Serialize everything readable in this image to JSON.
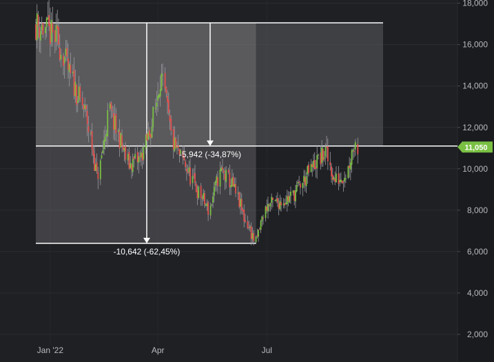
{
  "chart_data": {
    "type": "candlestick",
    "y_ticks": [
      "2,000",
      "4,000",
      "6,000",
      "8,000",
      "10,000",
      "12,000",
      "14,000",
      "16,000",
      "18,000"
    ],
    "y_tick_values": [
      2000,
      4000,
      6000,
      8000,
      10000,
      12000,
      14000,
      16000,
      18000
    ],
    "ylim": [
      1000,
      18000
    ],
    "x_ticks": [
      "Jan '22",
      "Apr",
      "Jul"
    ],
    "x_tick_dates": [
      "2022-01-01",
      "2022-04-01",
      "2022-07-01"
    ],
    "current_price": {
      "label": "11,050",
      "value": 11050,
      "color": "#7ac043"
    },
    "annotations": [
      {
        "text": "-5,942 (-34,87%)",
        "from_value": 17050,
        "to_value": 11100
      },
      {
        "text": "-10,642 (-62,45%)",
        "from_value": 17050,
        "to_value": 6400
      }
    ],
    "measure_range": {
      "start": "2021-12-20",
      "end": "2022-06-22"
    },
    "colors": {
      "up": "#7ac043",
      "down": "#e2524f"
    },
    "series": [
      {
        "date": "2021-12-20",
        "value": 17000
      },
      {
        "date": "2021-12-29",
        "value": 16700
      },
      {
        "date": "2022-01-08",
        "value": 16200
      },
      {
        "date": "2022-01-18",
        "value": 14500
      },
      {
        "date": "2022-02-01",
        "value": 12500
      },
      {
        "date": "2022-02-10",
        "value": 9500
      },
      {
        "date": "2022-02-20",
        "value": 12800
      },
      {
        "date": "2022-02-28",
        "value": 11500
      },
      {
        "date": "2022-03-08",
        "value": 10200
      },
      {
        "date": "2022-03-18",
        "value": 10500
      },
      {
        "date": "2022-03-28",
        "value": 12200
      },
      {
        "date": "2022-04-04",
        "value": 14600
      },
      {
        "date": "2022-04-14",
        "value": 11200
      },
      {
        "date": "2022-04-24",
        "value": 10200
      },
      {
        "date": "2022-05-04",
        "value": 9000
      },
      {
        "date": "2022-05-14",
        "value": 8000
      },
      {
        "date": "2022-05-24",
        "value": 9900
      },
      {
        "date": "2022-06-03",
        "value": 9200
      },
      {
        "date": "2022-06-13",
        "value": 7600
      },
      {
        "date": "2022-06-22",
        "value": 6450
      },
      {
        "date": "2022-07-01",
        "value": 8200
      },
      {
        "date": "2022-07-11",
        "value": 8400
      },
      {
        "date": "2022-07-21",
        "value": 8600
      },
      {
        "date": "2022-07-31",
        "value": 9300
      },
      {
        "date": "2022-08-10",
        "value": 10200
      },
      {
        "date": "2022-08-20",
        "value": 10800
      },
      {
        "date": "2022-08-27",
        "value": 9400
      },
      {
        "date": "2022-09-06",
        "value": 9800
      },
      {
        "date": "2022-09-12",
        "value": 11200
      },
      {
        "date": "2022-09-16",
        "value": 11050
      }
    ]
  }
}
